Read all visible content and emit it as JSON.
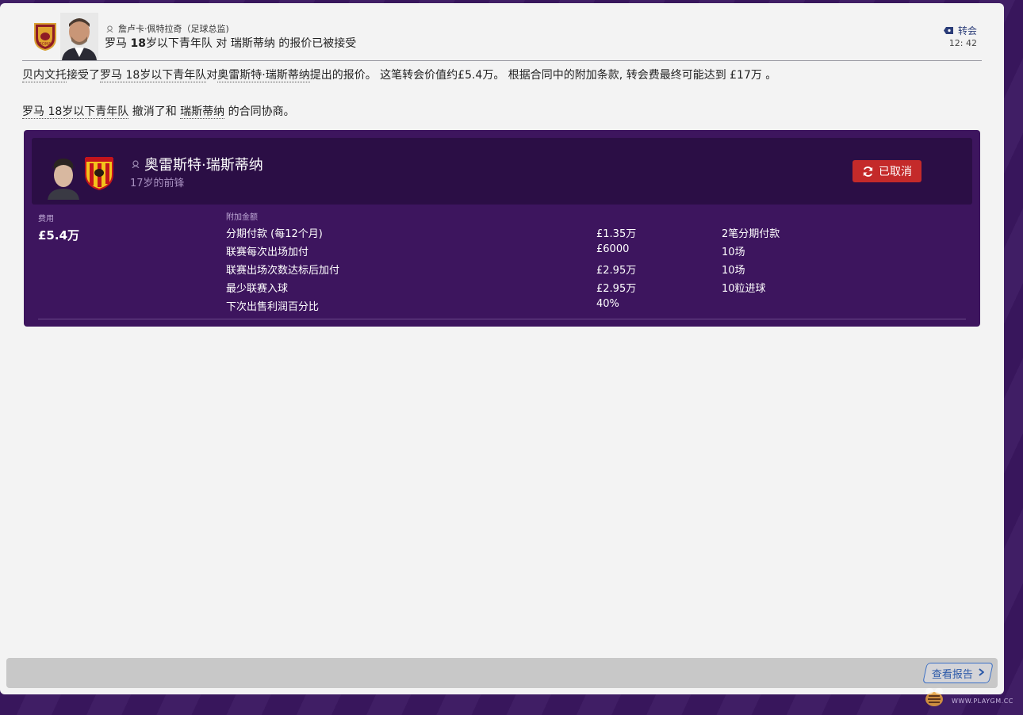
{
  "header": {
    "sender": "詹卢卡·佩特拉奇（足球总监)",
    "subject_part1": "罗马 ",
    "subject_bold": "18",
    "subject_part2": "岁以下青年队 对 瑞斯蒂纳 的报价已被接受",
    "category": "转会",
    "time": "12: 42"
  },
  "body": {
    "p1_a": "贝内文托",
    "p1_b": "接受了",
    "p1_c": "罗马 18岁以下青年队",
    "p1_d": "对",
    "p1_e": "奥雷斯特·瑞斯蒂纳",
    "p1_f": "提出的报价。 这笔转会价值约£5.4万。 根据合同中的附加条款, 转会费最终可能达到 £17万 。",
    "p2_a": "罗马 18岁以下青年队",
    "p2_b": " 撤消了和 ",
    "p2_c": "瑞斯蒂纳",
    "p2_d": " 的合同协商。"
  },
  "card": {
    "player_name": "奥雷斯特·瑞斯蒂纳",
    "player_desc": "17岁的前锋",
    "status_label": "已取消",
    "fee_label": "费用",
    "fee_value": "£5.4万",
    "extras_label": "附加金额",
    "extras": [
      {
        "name": "分期付款 (每12个月)",
        "amount": "£1.35万",
        "condition": "2笔分期付款"
      },
      {
        "name": "联赛每次出场加付",
        "amount": "£6000",
        "condition": "10场"
      },
      {
        "name": "联赛出场次数达标后加付",
        "amount": "£2.95万",
        "condition": "10场"
      },
      {
        "name": "最少联赛入球",
        "amount": "£2.95万",
        "condition": "10粒进球"
      },
      {
        "name": "下次出售利润百分比",
        "amount": "40%",
        "condition": ""
      }
    ]
  },
  "footer": {
    "report_label": "查看报告"
  },
  "watermark": "WWW.PLAYGM.CC",
  "colors": {
    "background": "#3a1760",
    "card": "#3d155e",
    "card_head": "#2b0e45",
    "cancel_button": "#c42a2a",
    "report_button": "#3b6fc4"
  }
}
